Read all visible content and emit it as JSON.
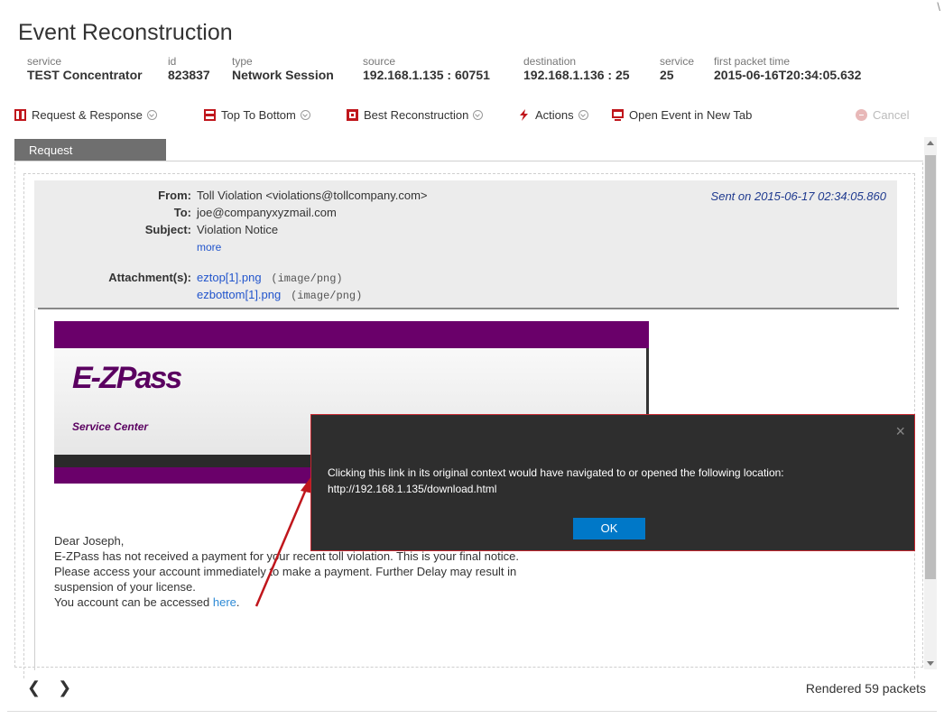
{
  "title": "Event Reconstruction",
  "meta": [
    {
      "label": "service",
      "value": "TEST Concentrator"
    },
    {
      "label": "id",
      "value": "823837"
    },
    {
      "label": "type",
      "value": "Network Session"
    },
    {
      "label": "source",
      "value": "192.168.1.135 : 60751"
    },
    {
      "label": "destination",
      "value": "192.168.1.136 : 25"
    },
    {
      "label": "service",
      "value": "25"
    },
    {
      "label": "first packet time",
      "value": "2015-06-16T20:34:05.632"
    }
  ],
  "toolbar": {
    "request_response": "Request & Response",
    "top_to_bottom": "Top To Bottom",
    "best_reconstruction": "Best Reconstruction",
    "actions": "Actions",
    "open_event": "Open Event in New Tab",
    "cancel": "Cancel"
  },
  "request_tab": "Request",
  "email": {
    "from_label": "From:",
    "from": "Toll Violation <violations@tollcompany.com>",
    "to_label": "To:",
    "to": "joe@companyxyzmail.com",
    "subject_label": "Subject:",
    "subject": "Violation Notice",
    "more": "more",
    "attachments_label": "Attachment(s):",
    "attachments": [
      {
        "name": "eztop[1].png",
        "type": "(image/png)"
      },
      {
        "name": "ezbottom[1].png",
        "type": "(image/png)"
      }
    ],
    "sent": "Sent on 2015-06-17 02:34:05.860"
  },
  "banner": {
    "logo": "E-ZPass",
    "service_center": "Service Center"
  },
  "letter": {
    "greeting": "Dear Joseph,",
    "line1": "E-ZPass has not received a payment for your recent toll violation. This is your final notice.",
    "line2": "Please access your account immediately to make a payment. Further Delay may result in",
    "line3": "suspension of your license.",
    "line4_prefix": "You account can be accessed ",
    "line4_link": "here",
    "line4_suffix": "."
  },
  "dialog": {
    "message": "Clicking this link in its original context would have navigated to or opened the following location:",
    "url": "http://192.168.1.135/download.html",
    "ok": "OK",
    "close": "×"
  },
  "footer": {
    "prev": "❮",
    "next": "❯",
    "rendered": "Rendered 59 packets"
  },
  "colors": {
    "dialog_bg": "#2e2e2e",
    "dialog_border": "#c4262e",
    "ok_button": "#0078c8",
    "ezpass_purple": "#6a006a",
    "link": "#2255cc",
    "annotation_arrow": "#c0161c"
  },
  "icons": {
    "request_response": "split-view-icon",
    "top_to_bottom": "stacked-view-icon",
    "best_reconstruction": "reconstruction-icon",
    "actions": "lightning-icon",
    "open_event": "new-tab-icon",
    "cancel": "cancel-icon"
  }
}
